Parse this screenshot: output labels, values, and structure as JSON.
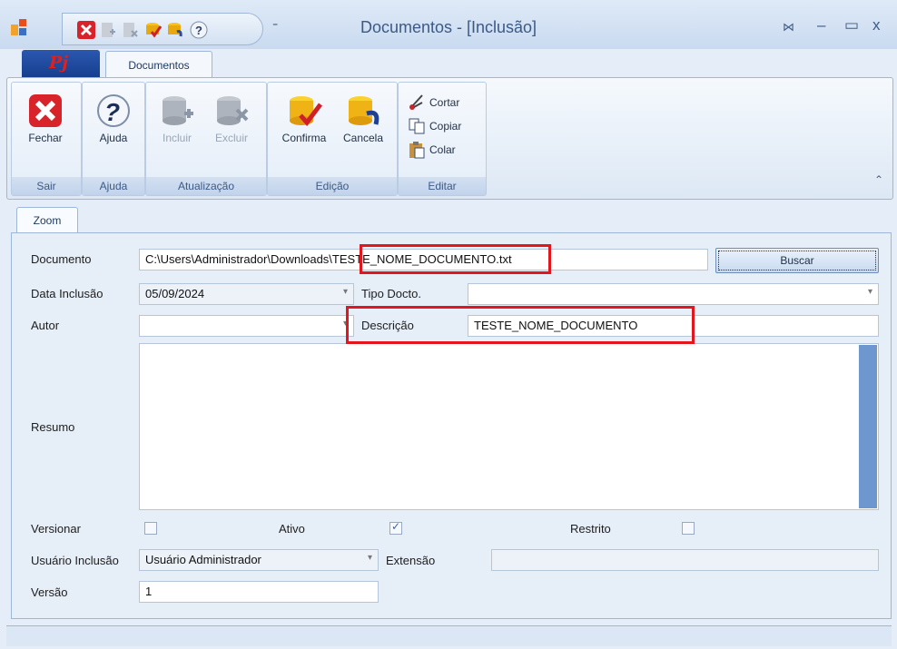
{
  "window": {
    "title": "Documentos - [Inclusão]"
  },
  "ribbon": {
    "app_button": "Pj",
    "tab": "Documentos",
    "groups": {
      "sair": {
        "label": "Sair",
        "fechar": "Fechar"
      },
      "ajuda": {
        "label": "Ajuda",
        "ajuda": "Ajuda"
      },
      "atualizacao": {
        "label": "Atualização",
        "incluir": "Incluir",
        "excluir": "Excluir"
      },
      "edicao": {
        "label": "Edição",
        "confirma": "Confirma",
        "cancela": "Cancela"
      },
      "editar": {
        "label": "Editar",
        "cortar": "Cortar",
        "copiar": "Copiar",
        "colar": "Colar"
      }
    }
  },
  "zoom_tab": "Zoom",
  "form": {
    "documento": {
      "label": "Documento",
      "value": "C:\\Users\\Administrador\\Downloads\\TESTE_NOME_DOCUMENTO.txt"
    },
    "buscar": "Buscar",
    "data_inclusao": {
      "label": "Data Inclusão",
      "value": "05/09/2024"
    },
    "tipo_docto": {
      "label": "Tipo Docto.",
      "value": ""
    },
    "autor": {
      "label": "Autor",
      "value": ""
    },
    "descricao": {
      "label": "Descrição",
      "value": "TESTE_NOME_DOCUMENTO"
    },
    "resumo": {
      "label": "Resumo",
      "value": ""
    },
    "versionar": {
      "label": "Versionar",
      "checked": false
    },
    "ativo": {
      "label": "Ativo",
      "checked": true
    },
    "restrito": {
      "label": "Restrito",
      "checked": false
    },
    "usuario_inclusao": {
      "label": "Usuário Inclusão",
      "value": "Usuário Administrador"
    },
    "extensao": {
      "label": "Extensão",
      "value": ""
    },
    "versao": {
      "label": "Versão",
      "value": "1"
    }
  },
  "colors": {
    "highlight": "#e3161e",
    "accent": "#3c5a86"
  }
}
